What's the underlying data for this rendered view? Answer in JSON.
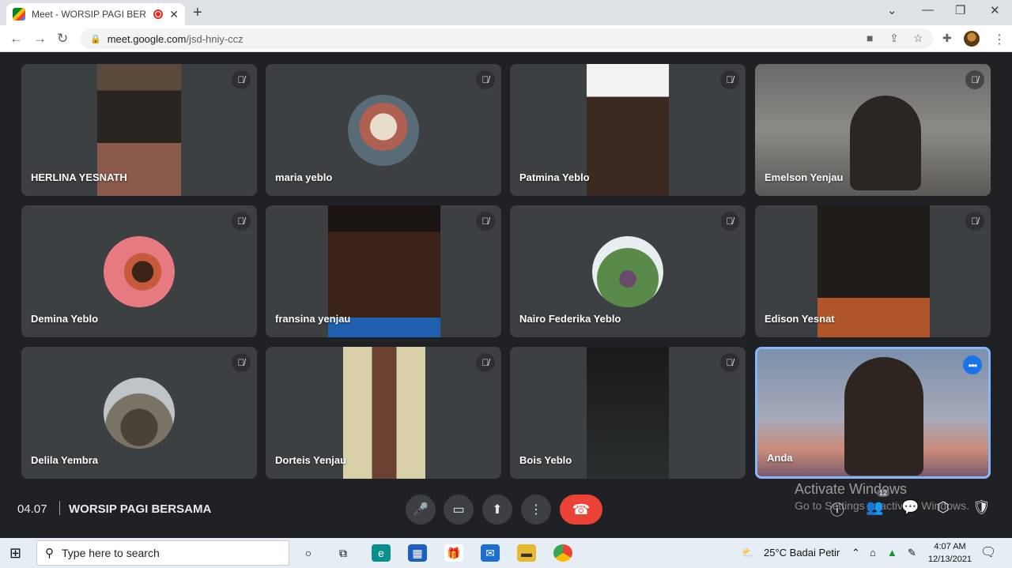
{
  "browser": {
    "tab_title": "Meet - WORSIP PAGI BERSAMA",
    "new_tab": "+",
    "url_host": "meet.google.com",
    "url_path": "/jsd-hniy-ccz"
  },
  "participants": [
    {
      "name": "HERLINA YESNATH"
    },
    {
      "name": "maria yeblo"
    },
    {
      "name": "Patmina Yeblo"
    },
    {
      "name": "Emelson Yenjau"
    },
    {
      "name": "Demina Yeblo"
    },
    {
      "name": "fransina yenjau"
    },
    {
      "name": "Nairo Federika Yeblo"
    },
    {
      "name": "Edison Yesnat"
    },
    {
      "name": "Delila Yembra"
    },
    {
      "name": "Dorteis Yenjau"
    },
    {
      "name": "Bois Yeblo"
    },
    {
      "name": "Anda"
    }
  ],
  "meeting": {
    "time": "04.07",
    "title": "WORSIP PAGI BERSAMA",
    "participant_count": "12"
  },
  "watermark": {
    "line1": "Activate Windows",
    "line2": "Go to Settings to activate Windows."
  },
  "taskbar": {
    "search_placeholder": "Type here to search",
    "weather": "25°C  Badai Petir",
    "clock_time": "4:07 AM",
    "clock_date": "12/13/2021"
  },
  "colors": {
    "meet_bg": "#202124",
    "tile_bg": "#3c4043",
    "hangup": "#ea4335",
    "accent": "#1a73e8"
  }
}
